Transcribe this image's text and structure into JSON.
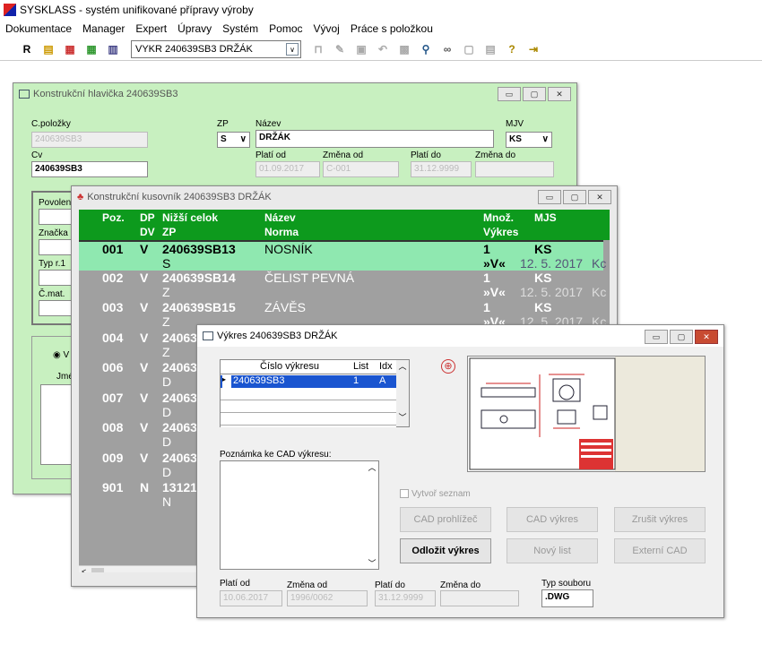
{
  "app": {
    "title": "SYSKLASS - systém unifikované přípravy výroby"
  },
  "menu": [
    "Dokumentace",
    "Manager",
    "Expert",
    "Úpravy",
    "Systém",
    "Pomoc",
    "Vývoj",
    "Práce s položkou"
  ],
  "toolbar": {
    "r_label": "R",
    "combo_value": "VYKR 240639SB3 DRŽÁK"
  },
  "hlavicka": {
    "title": "Konstrukční hlavička  240639SB3",
    "cpolozky_label": "C.položky",
    "cpolozky_value": "240639SB3",
    "zp_label": "ZP",
    "zp_value": "S",
    "nazev_label": "Název",
    "nazev_value": "DRŽÁK",
    "mjv_label": "MJV",
    "mjv_value": "KS",
    "cv_label": "Cv",
    "cv_value": "240639SB3",
    "plati_od_label": "Platí od",
    "plati_od_value": "01.09.2017",
    "zmena_od_label": "Změna od",
    "zmena_od_value": "C-001",
    "plati_do_label": "Platí do",
    "plati_do_value": "31.12.9999",
    "zmena_do_label": "Změna do",
    "povolen": "Povolen",
    "znacka": "Značka",
    "typr": "Typ r.1",
    "cmat": "Č.mat.",
    "v_label": "V",
    "jme": "Jmé"
  },
  "kusovnik": {
    "title": "Konstrukční kusovník  240639SB3 DRŽÁK",
    "headers": {
      "poz": "Poz.",
      "dp": "DP",
      "dv": "DV",
      "nizsi": "Nižší celok",
      "zp": "ZP",
      "nazev": "Název",
      "norma": "Norma",
      "mnoz": "Množ.",
      "vykres": "Výkres",
      "mjs": "MJS"
    },
    "rows": [
      {
        "poz": "001",
        "dp": "V",
        "celek": "240639SB13",
        "zp": "S",
        "nazev": "NOSNÍK",
        "mnoz": "1",
        "mjs": "KS",
        "vyk": "»V«",
        "date": "12. 5. 2017",
        "kc": "Kc"
      },
      {
        "poz": "002",
        "dp": "V",
        "celek": "240639SB14",
        "zp": "Z",
        "nazev": "ČELIST PEVNÁ",
        "mnoz": "1",
        "mjs": "KS",
        "vyk": "»V«",
        "date": "12. 5. 2017",
        "kc": "Kc"
      },
      {
        "poz": "003",
        "dp": "V",
        "celek": "240639SB15",
        "zp": "Z",
        "nazev": "ZÁVĚS",
        "mnoz": "1",
        "mjs": "KS",
        "vyk": "»V«",
        "date": "12. 5. 2017",
        "kc": "Kc"
      },
      {
        "poz": "004",
        "dp": "V",
        "celek": "24063",
        "zp": "Z"
      },
      {
        "poz": "006",
        "dp": "V",
        "celek": "24063",
        "zp": "D"
      },
      {
        "poz": "007",
        "dp": "V",
        "celek": "24063",
        "zp": "D"
      },
      {
        "poz": "008",
        "dp": "V",
        "celek": "24063",
        "zp": "D"
      },
      {
        "poz": "009",
        "dp": "V",
        "celek": "24063",
        "zp": "D"
      },
      {
        "poz": "901",
        "dp": "N",
        "celek": "13121",
        "zp": "N"
      }
    ]
  },
  "vykres": {
    "title": "Výkres 240639SB3 DRŽÁK",
    "col_cislo": "Číslo výkresu",
    "col_list": "List",
    "col_idx": "Idx",
    "row_cislo": "240639SB3",
    "row_list": "1",
    "row_idx": "A",
    "poznamka_label": "Poznámka ke CAD výkresu:",
    "vytvor": "Vytvoř seznam",
    "btn_cad_prohlizec": "CAD prohlížeč",
    "btn_cad_vykres": "CAD výkres",
    "btn_zrusit": "Zrušit výkres",
    "btn_odlozit": "Odložit výkres",
    "btn_novy_list": "Nový list",
    "btn_externi": "Externí CAD",
    "plati_od_label": "Platí od",
    "plati_od_value": "10.06.2017",
    "zmena_od_label": "Změna od",
    "zmena_od_value": "1996/0062",
    "plati_do_label": "Platí do",
    "plati_do_value": "31.12.9999",
    "zmena_do_label": "Změna do",
    "typ_label": "Typ souboru",
    "typ_value": ".DWG"
  }
}
